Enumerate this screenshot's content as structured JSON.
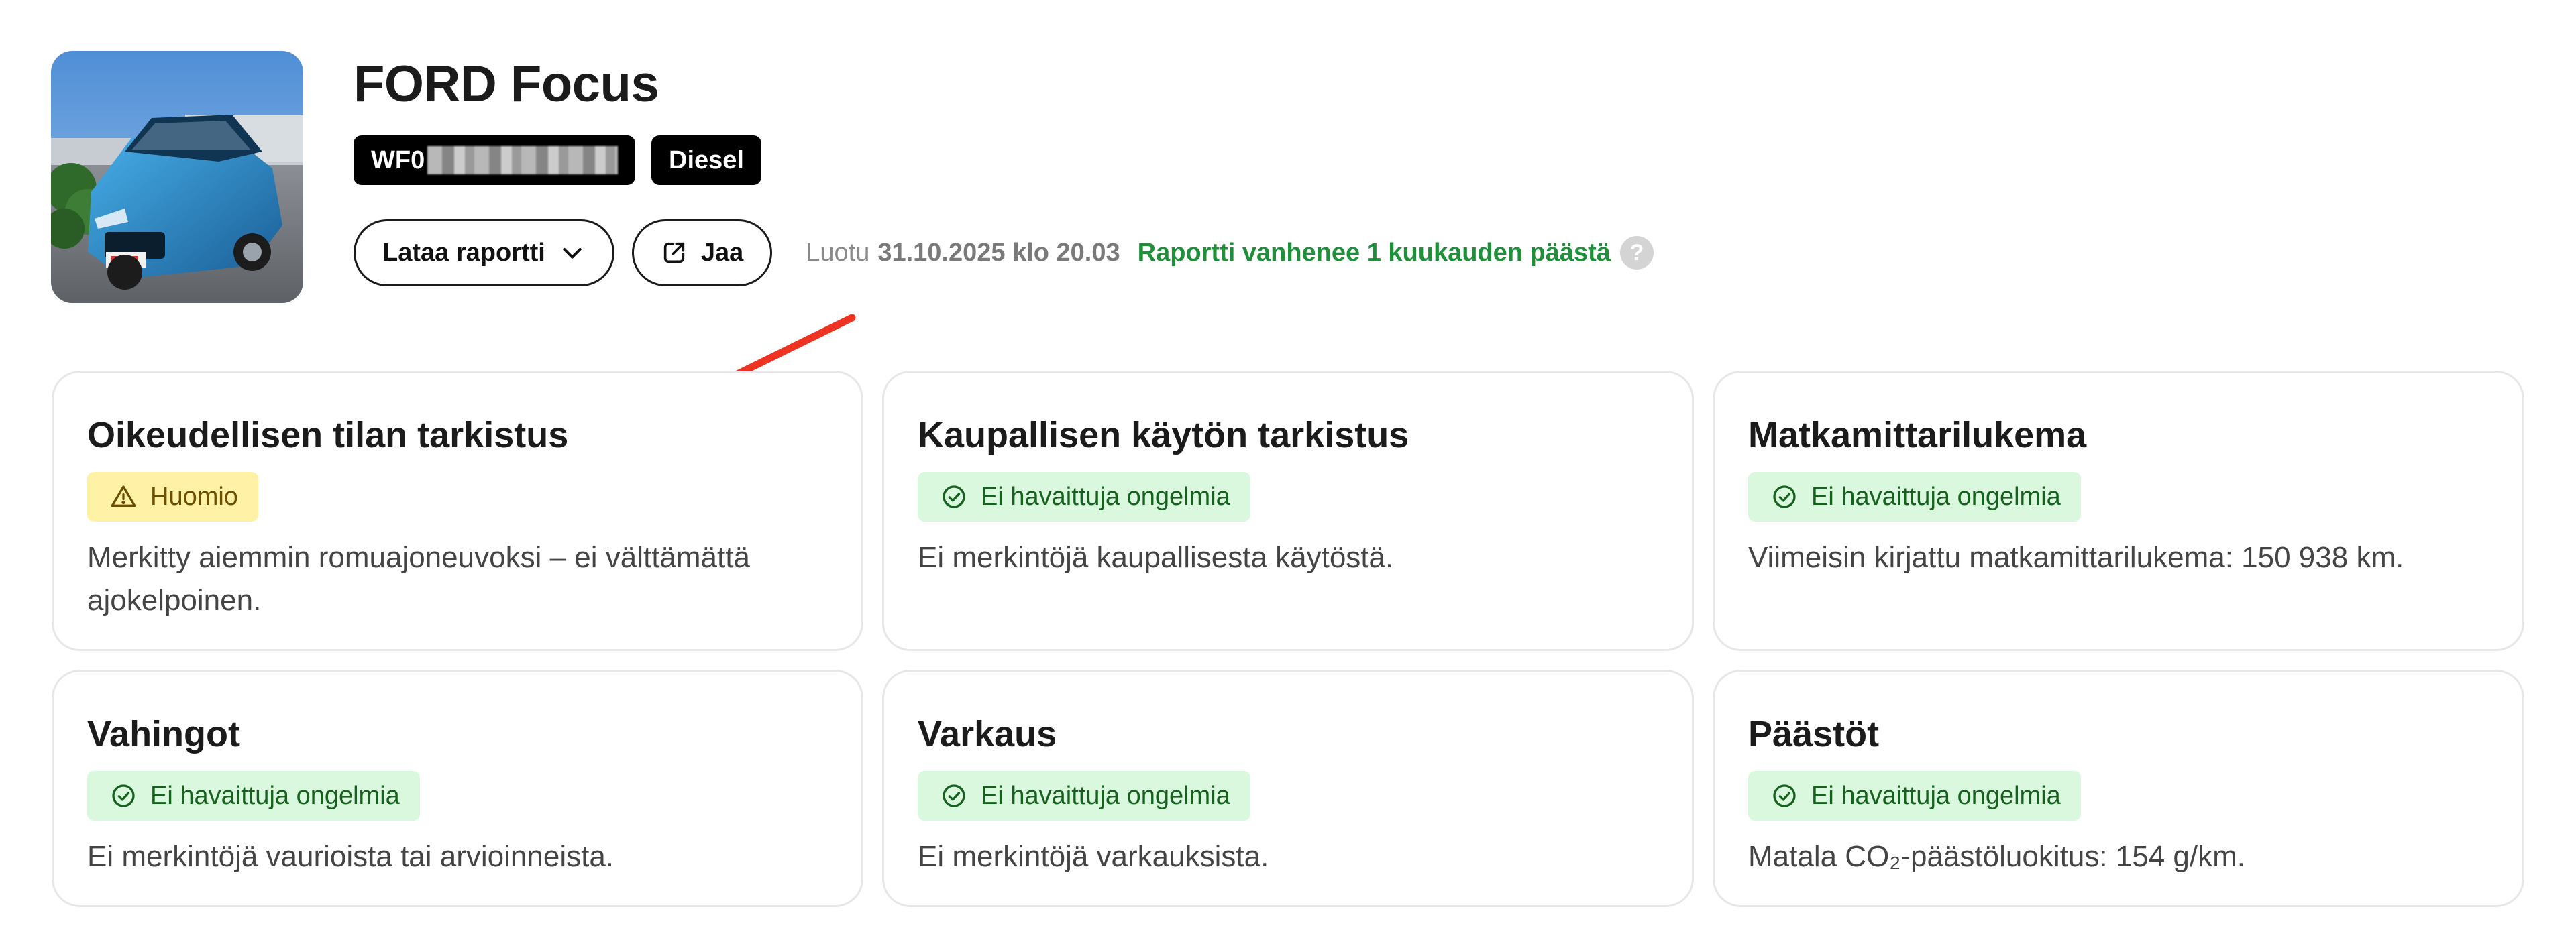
{
  "vehicle": {
    "title": "FORD Focus",
    "vin_prefix": "WF0",
    "fuel": "Diesel"
  },
  "actions": {
    "download_label": "Lataa raportti",
    "share_label": "Jaa"
  },
  "meta": {
    "created_label": "Luotu",
    "created_date": "31.10.2025 klo 20.03",
    "expiry_text": "Raportti vanhenee 1 kuukauden päästä",
    "help_glyph": "?"
  },
  "cards": [
    {
      "title": "Oikeudellisen tilan tarkistus",
      "status": "Huomio",
      "status_type": "warn",
      "description": "Merkitty aiemmin romuajoneuvoksi – ei välttämättä ajokelpoinen."
    },
    {
      "title": "Kaupallisen käytön tarkistus",
      "status": "Ei havaittuja ongelmia",
      "status_type": "ok",
      "description": "Ei merkintöjä kaupallisesta käytöstä."
    },
    {
      "title": "Matkamittarilukema",
      "status": "Ei havaittuja ongelmia",
      "status_type": "ok",
      "description": "Viimeisin kirjattu matkamittarilukema: 150 938 km."
    },
    {
      "title": "Vahingot",
      "status": "Ei havaittuja ongelmia",
      "status_type": "ok",
      "description": "Ei merkintöjä vaurioista tai arvioinneista."
    },
    {
      "title": "Varkaus",
      "status": "Ei havaittuja ongelmia",
      "status_type": "ok",
      "description": "Ei merkintöjä varkauksista."
    },
    {
      "title": "Päästöt",
      "status": "Ei havaittuja ongelmia",
      "status_type": "ok",
      "description": "Matala CO₂-päästöluokitus: 154 g/km."
    }
  ],
  "colors": {
    "ok_bg": "#d9f8de",
    "ok_text": "#17611f",
    "warn_bg": "#fff1a6",
    "warn_text": "#6a4f00",
    "expiry_green": "#1f8f3a",
    "arrow_red": "#ee3322"
  },
  "icons": {
    "photo": "car-photo",
    "download": "chevron-down-icon",
    "share": "share-icon",
    "help": "question-icon",
    "ok": "check-circle-icon",
    "warn": "warning-triangle-icon"
  }
}
